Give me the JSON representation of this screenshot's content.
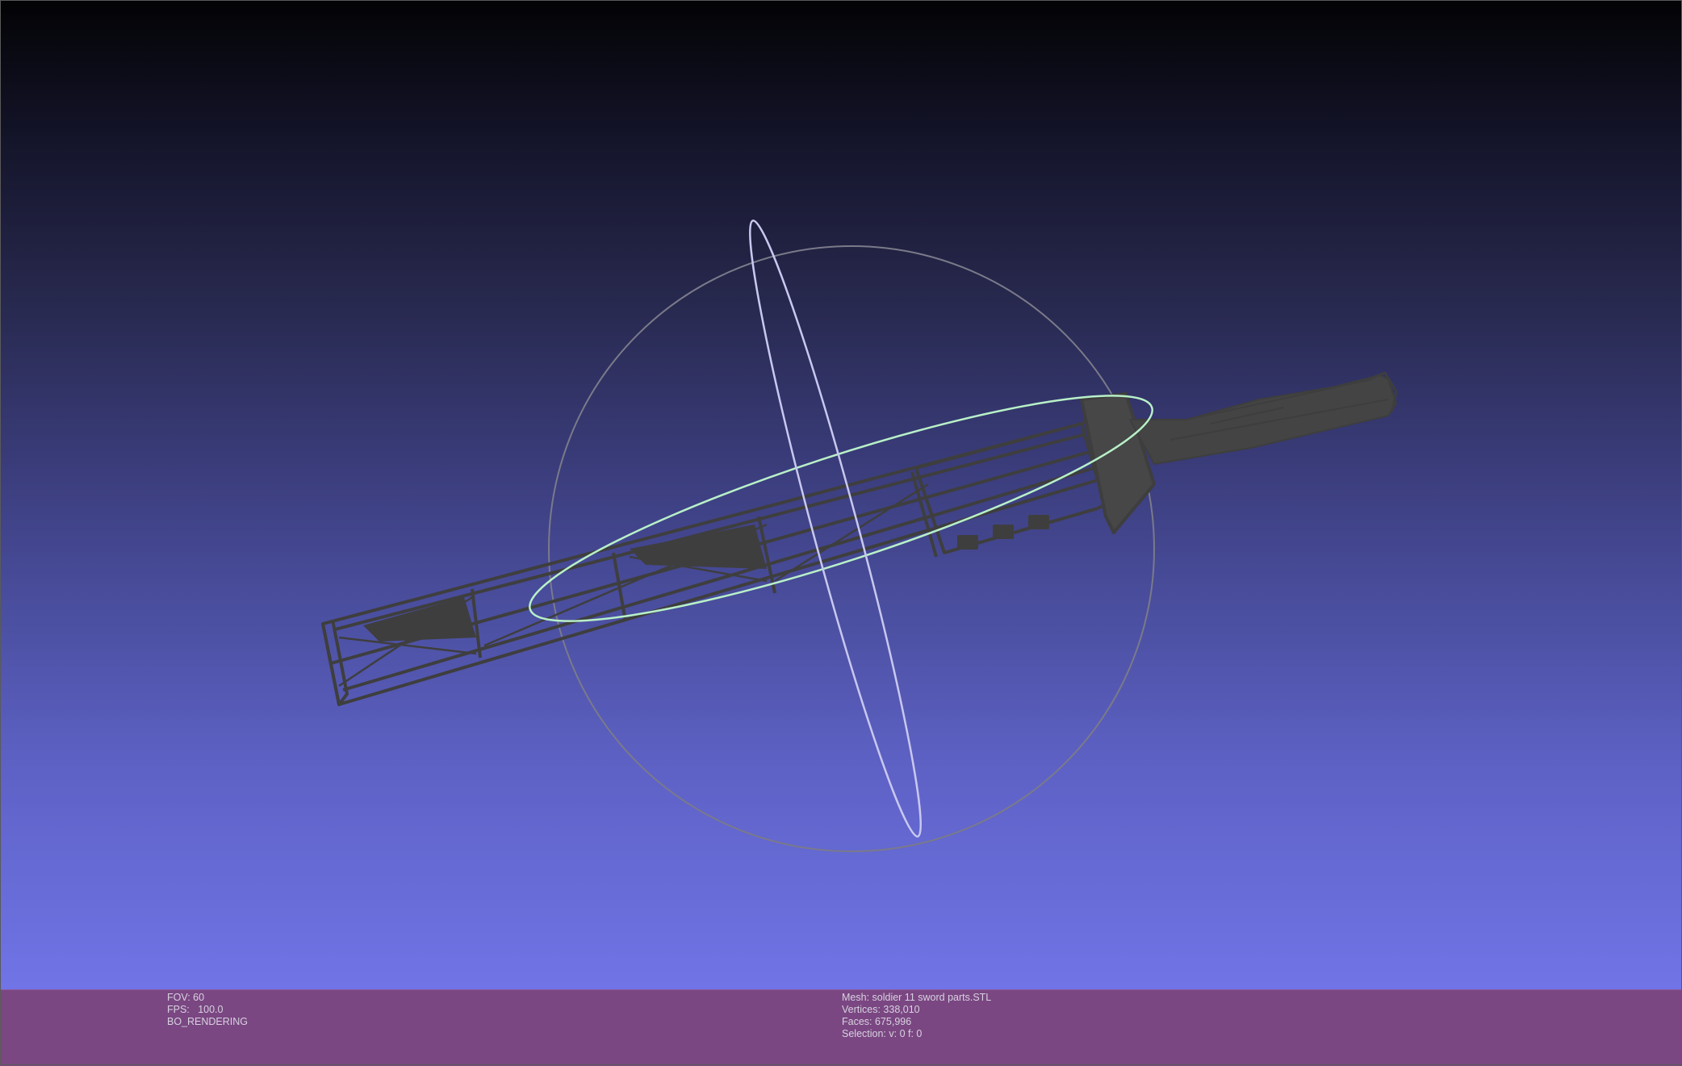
{
  "viewer": {
    "name": "3D mesh viewport",
    "colors": {
      "background_top": "#030305",
      "background_bottom": "#7074e6",
      "info_bar": "#7a4782",
      "mesh_wireframe": "#3e3e3e",
      "trackball_circle": "#7a7a8a",
      "trackball_vertical_ring": "#c8c8f0",
      "trackball_horizontal_ring": "#b8f0c8"
    }
  },
  "info_left": {
    "fov": "FOV: 60",
    "fps": "FPS:   100.0",
    "render_mode": "BO_RENDERING"
  },
  "info_right": {
    "mesh": "Mesh: soldier 11 sword parts.STL",
    "vertices": "Vertices: 338,010",
    "faces": "Faces: 675,996",
    "selection": "Selection: v: 0 f: 0"
  }
}
